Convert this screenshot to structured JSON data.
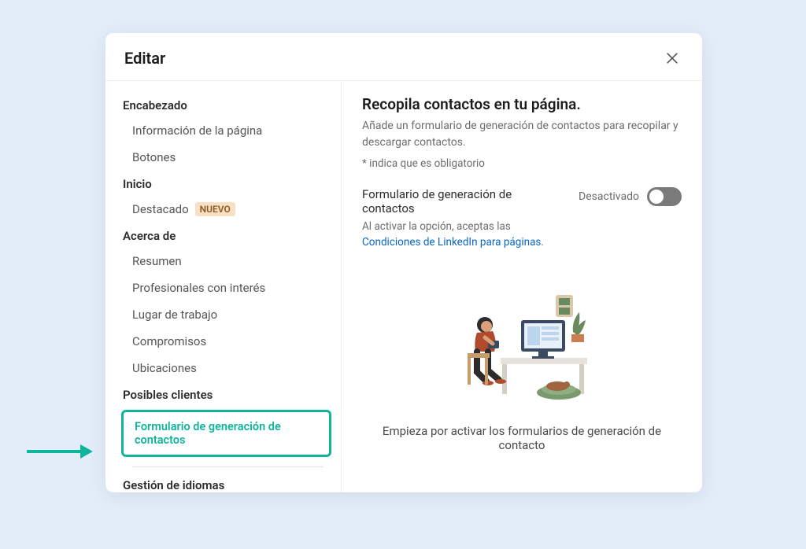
{
  "dialog": {
    "title": "Editar"
  },
  "sidebar": {
    "sections": [
      {
        "header": "Encabezado",
        "items": [
          {
            "label": "Información de la página"
          },
          {
            "label": "Botones"
          }
        ]
      },
      {
        "header": "Inicio",
        "items": [
          {
            "label": "Destacado",
            "badge": "NUEVO"
          }
        ]
      },
      {
        "header": "Acerca de",
        "items": [
          {
            "label": "Resumen"
          },
          {
            "label": "Profesionales con interés"
          },
          {
            "label": "Lugar de trabajo"
          },
          {
            "label": "Compromisos"
          },
          {
            "label": "Ubicaciones"
          }
        ]
      },
      {
        "header": "Posibles clientes",
        "items": [
          {
            "label": "Formulario de generación de contactos",
            "selected": true
          }
        ]
      }
    ],
    "footer_item": "Gestión de idiomas"
  },
  "main": {
    "title": "Recopila contactos en tu página.",
    "subtitle": "Añade un formulario de generación de contactos para recopilar y descargar contactos.",
    "required_note": "*  indica que es obligatorio",
    "toggle": {
      "title": "Formulario de generación de contactos",
      "desc_prefix": "Al activar la opción, aceptas las ",
      "desc_link": "Condiciones de LinkedIn para páginas",
      "desc_suffix": ".",
      "state_label": "Desactivado",
      "on": false
    },
    "illustration_caption": "Empieza por activar los formularios de generación de contacto"
  }
}
